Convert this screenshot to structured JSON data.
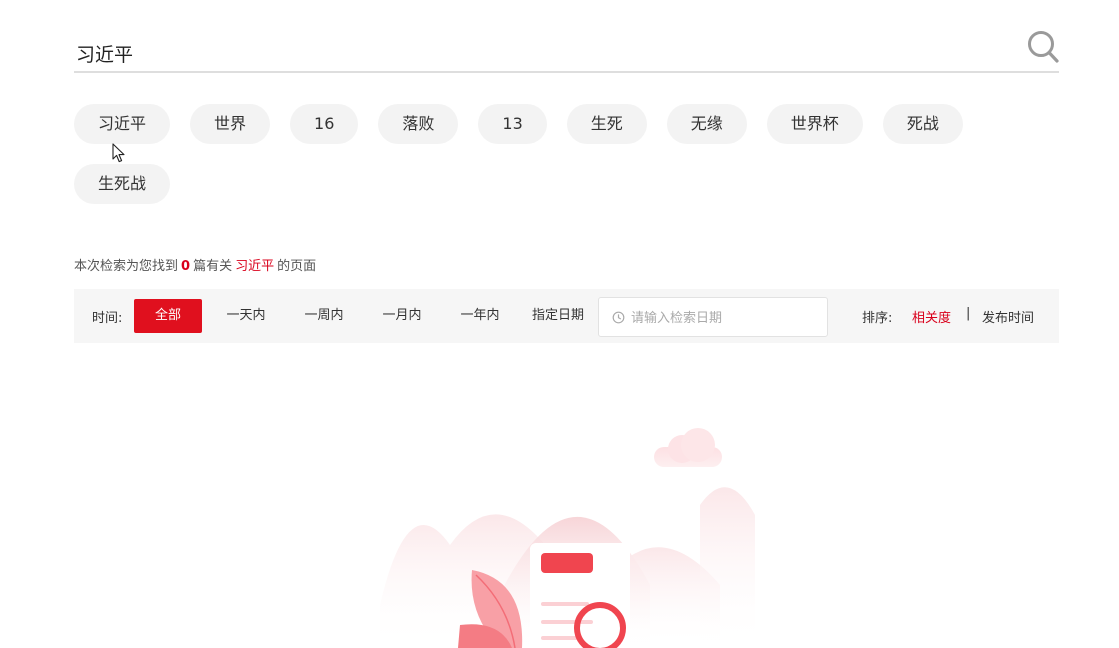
{
  "search": {
    "value": "习近平",
    "icon": "search-icon"
  },
  "chips": {
    "row1": [
      "习近平",
      "世界",
      "16",
      "落败",
      "13",
      "生死",
      "无缘",
      "世界杯",
      "死战"
    ],
    "row2": [
      "生死战"
    ]
  },
  "summary": {
    "prefix": "本次检索为您找到",
    "count": "0",
    "middle": "篇有关",
    "keyword": "习近平",
    "suffix": "的页面"
  },
  "filter": {
    "time_label": "时间:",
    "options": [
      "全部",
      "一天内",
      "一周内",
      "一月内",
      "一年内",
      "指定日期"
    ],
    "date_placeholder": "请输入检索日期",
    "sort_label": "排序:",
    "sort_relevance": "相关度",
    "sort_separator": "|",
    "sort_time": "发布时间"
  },
  "colors": {
    "accent": "#e0101e",
    "accent_text": "#d9001b",
    "chip_bg": "#f3f3f3",
    "filter_bg": "#f6f6f6"
  }
}
